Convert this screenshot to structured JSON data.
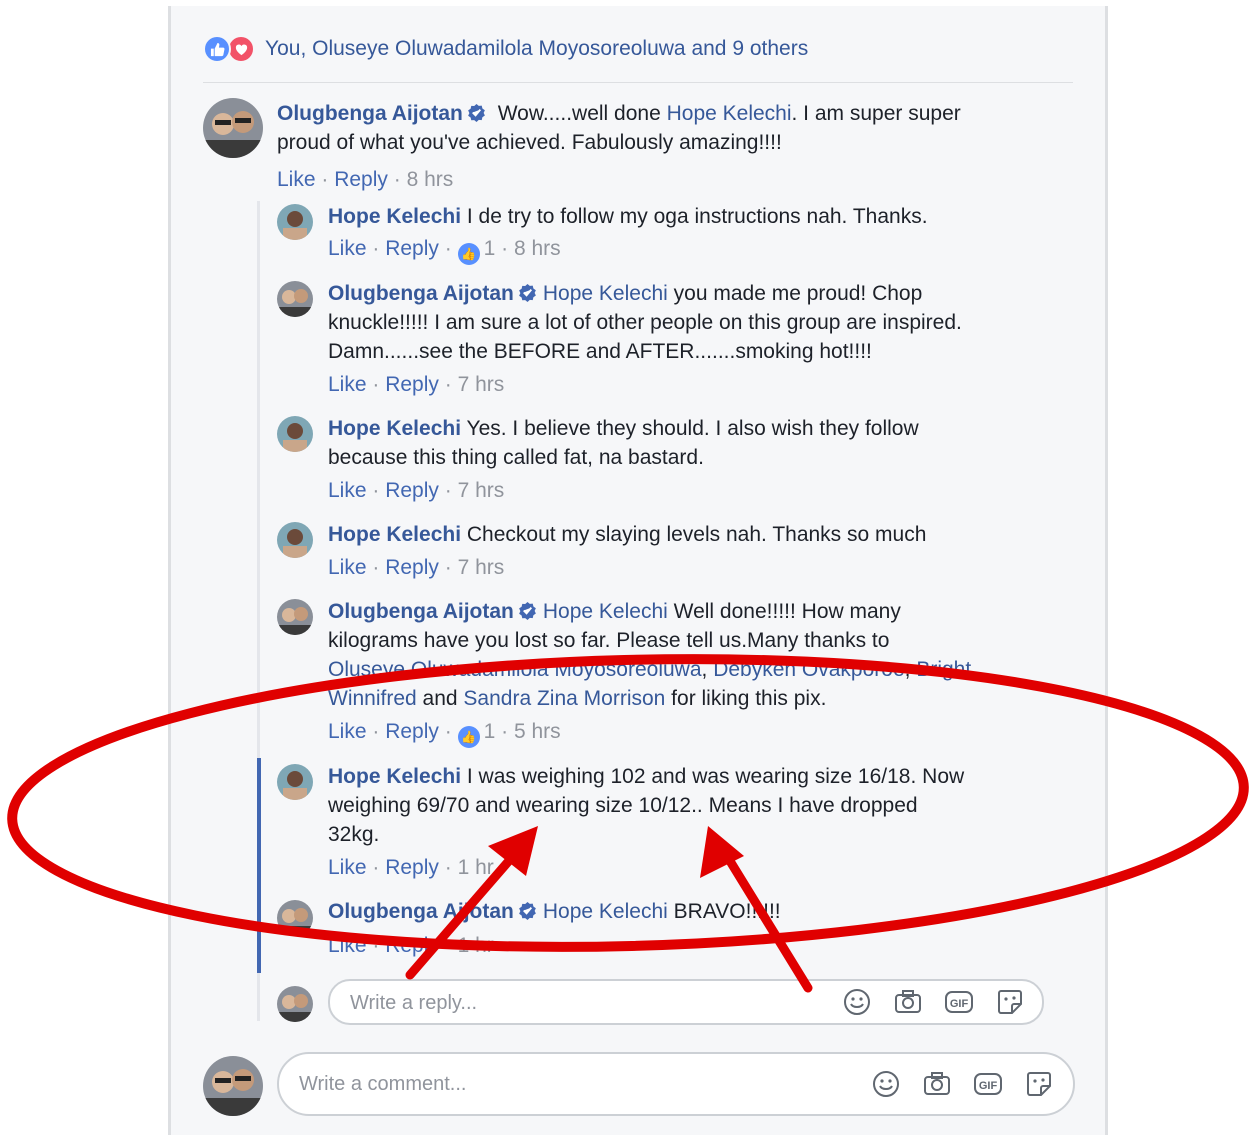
{
  "reactions": {
    "text": "You, Oluseye Oluwadamilola Moyosoreoluwa and 9 others",
    "icons": [
      "like-icon",
      "love-icon"
    ]
  },
  "colors": {
    "link": "#365899",
    "action": "#4267b2",
    "meta": "#90949c",
    "annotation": "#e00000"
  },
  "comments": [
    {
      "author": "Olugbenga Aijotan",
      "pre": "",
      "mention": "",
      "text1": " Wow.....well done ",
      "mention2": "Hope Kelechi",
      "text2": ". I am super super",
      "line2": "proud of what you've achieved. Fabulously amazing!!!!",
      "like": "Like",
      "reply": "Reply",
      "time": "8 hrs"
    },
    {
      "author": "Hope Kelechi",
      "text": " I de try to follow my oga instructions nah. Thanks.",
      "like": "Like",
      "reply": "Reply",
      "likes": "1",
      "time": "8 hrs"
    },
    {
      "author": "Olugbenga Aijotan",
      "mention": "Hope Kelechi",
      "text": " you made me proud! Chop",
      "line2": "knuckle!!!!! I am sure a lot of other people on this group are inspired.",
      "line3": "Damn......see the BEFORE and AFTER.......smoking hot!!!!",
      "like": "Like",
      "reply": "Reply",
      "time": "7 hrs"
    },
    {
      "author": "Hope Kelechi",
      "text": " Yes. I believe they should. I also wish they follow",
      "line2": "because this thing called fat, na bastard.",
      "like": "Like",
      "reply": "Reply",
      "time": "7 hrs"
    },
    {
      "author": "Hope Kelechi",
      "text": " Checkout my slaying levels nah. Thanks so much",
      "like": "Like",
      "reply": "Reply",
      "time": "7 hrs"
    },
    {
      "author": "Olugbenga Aijotan",
      "mention": "Hope Kelechi",
      "text": " Well done!!!!! How many",
      "line2": "kilograms have you lost so far. Please tell us.Many thanks to",
      "m1": "Oluseye Oluwadamilola Moyosoreoluwa",
      "sep1": ", ",
      "m2": "Debyken Ovakporoe",
      "sep2": ", ",
      "m3": "Bright",
      "m3b": "Winnifred",
      "and": " and ",
      "m4": "Sandra Zina Morrison",
      "tail": " for liking this pix.",
      "like": "Like",
      "reply": "Reply",
      "likes": "1",
      "time": "5 hrs"
    },
    {
      "author": "Hope Kelechi",
      "text": " I was weighing 102 and was wearing size 16/18. Now",
      "line2": "weighing 69/70 and wearing size 10/12.. Means I have dropped",
      "line3": "32kg.",
      "like": "Like",
      "reply": "Reply",
      "time": "1 hr"
    },
    {
      "author": "Olugbenga Aijotan",
      "mention": "Hope Kelechi",
      "text": " BRAVO!!!!!!",
      "like": "Like",
      "reply": "Reply",
      "time": "1 hr"
    }
  ],
  "reply_input": {
    "placeholder": "Write a reply..."
  },
  "comment_input": {
    "placeholder": "Write a comment..."
  },
  "tools": [
    "smiley-icon",
    "camera-icon",
    "gif-icon",
    "sticker-icon"
  ],
  "sep": " · "
}
